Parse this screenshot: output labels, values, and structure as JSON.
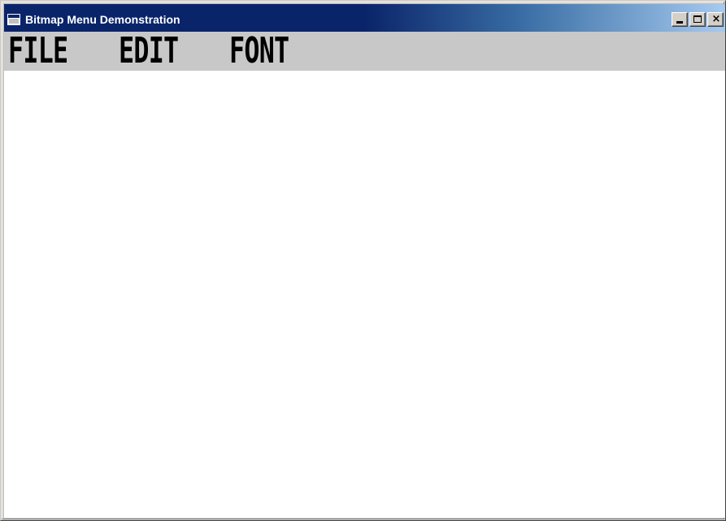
{
  "window": {
    "title": "Bitmap Menu Demonstration",
    "icon": "app-window-icon",
    "caption_buttons": {
      "minimize": "minimize-icon",
      "maximize": "maximize-icon",
      "close": "close-icon",
      "close_glyph": "×"
    }
  },
  "menubar": {
    "items": [
      {
        "label": "FILE"
      },
      {
        "label": "EDIT"
      },
      {
        "label": "FONT"
      }
    ]
  },
  "colors": {
    "titlebar_start": "#0a246a",
    "titlebar_end": "#a6caf0",
    "menubar_bg": "#c8c8c8",
    "client_bg": "#ffffff"
  }
}
